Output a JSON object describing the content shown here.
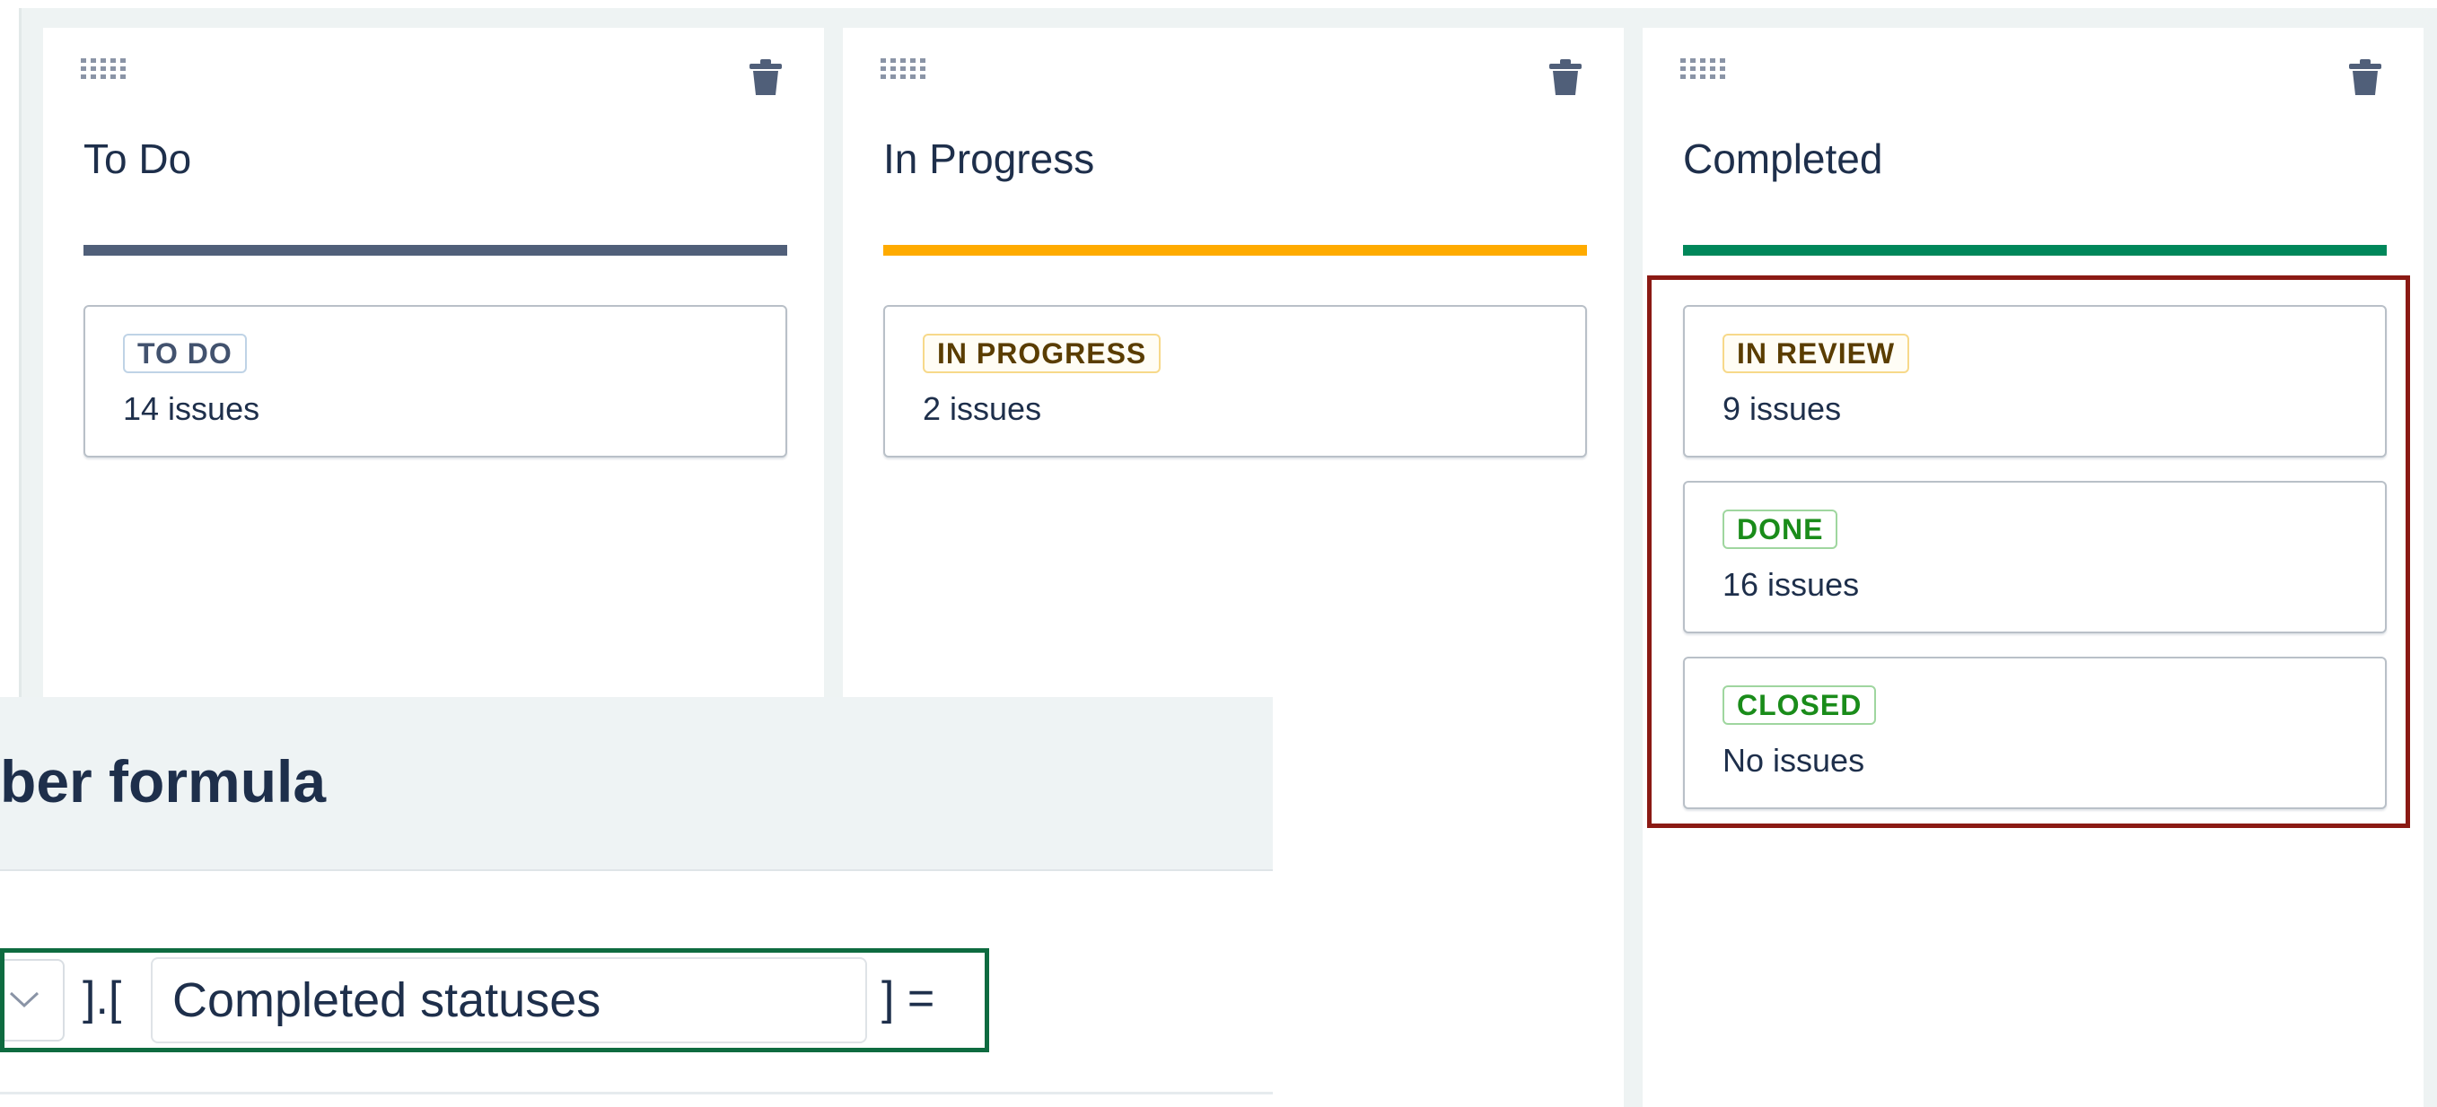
{
  "board": {
    "columns": [
      {
        "title": "To Do",
        "bar_color": "#505f79",
        "cards": [
          {
            "status": "TO DO",
            "count": "14 issues",
            "tone": "todo"
          }
        ]
      },
      {
        "title": "In Progress",
        "bar_color": "#ffab00",
        "cards": [
          {
            "status": "IN PROGRESS",
            "count": "2 issues",
            "tone": "inprog"
          }
        ]
      },
      {
        "title": "Completed",
        "bar_color": "#00875a",
        "cards": [
          {
            "status": "IN REVIEW",
            "count": "9 issues",
            "tone": "inprog"
          },
          {
            "status": "DONE",
            "count": "16 issues",
            "tone": "done"
          },
          {
            "status": "CLOSED",
            "count": "No issues",
            "tone": "done"
          }
        ]
      }
    ],
    "icons": {
      "drag": "drag-handle-icon",
      "delete": "trash-icon"
    }
  },
  "formula": {
    "title_fragment": "ber formula",
    "open_bracket": "].[",
    "field_value": "Completed statuses",
    "close_eq": "]  =",
    "dropdown_icon": "chevron-down-icon"
  },
  "highlights": {
    "red": "#8b1a14",
    "green": "#0e6b40"
  }
}
